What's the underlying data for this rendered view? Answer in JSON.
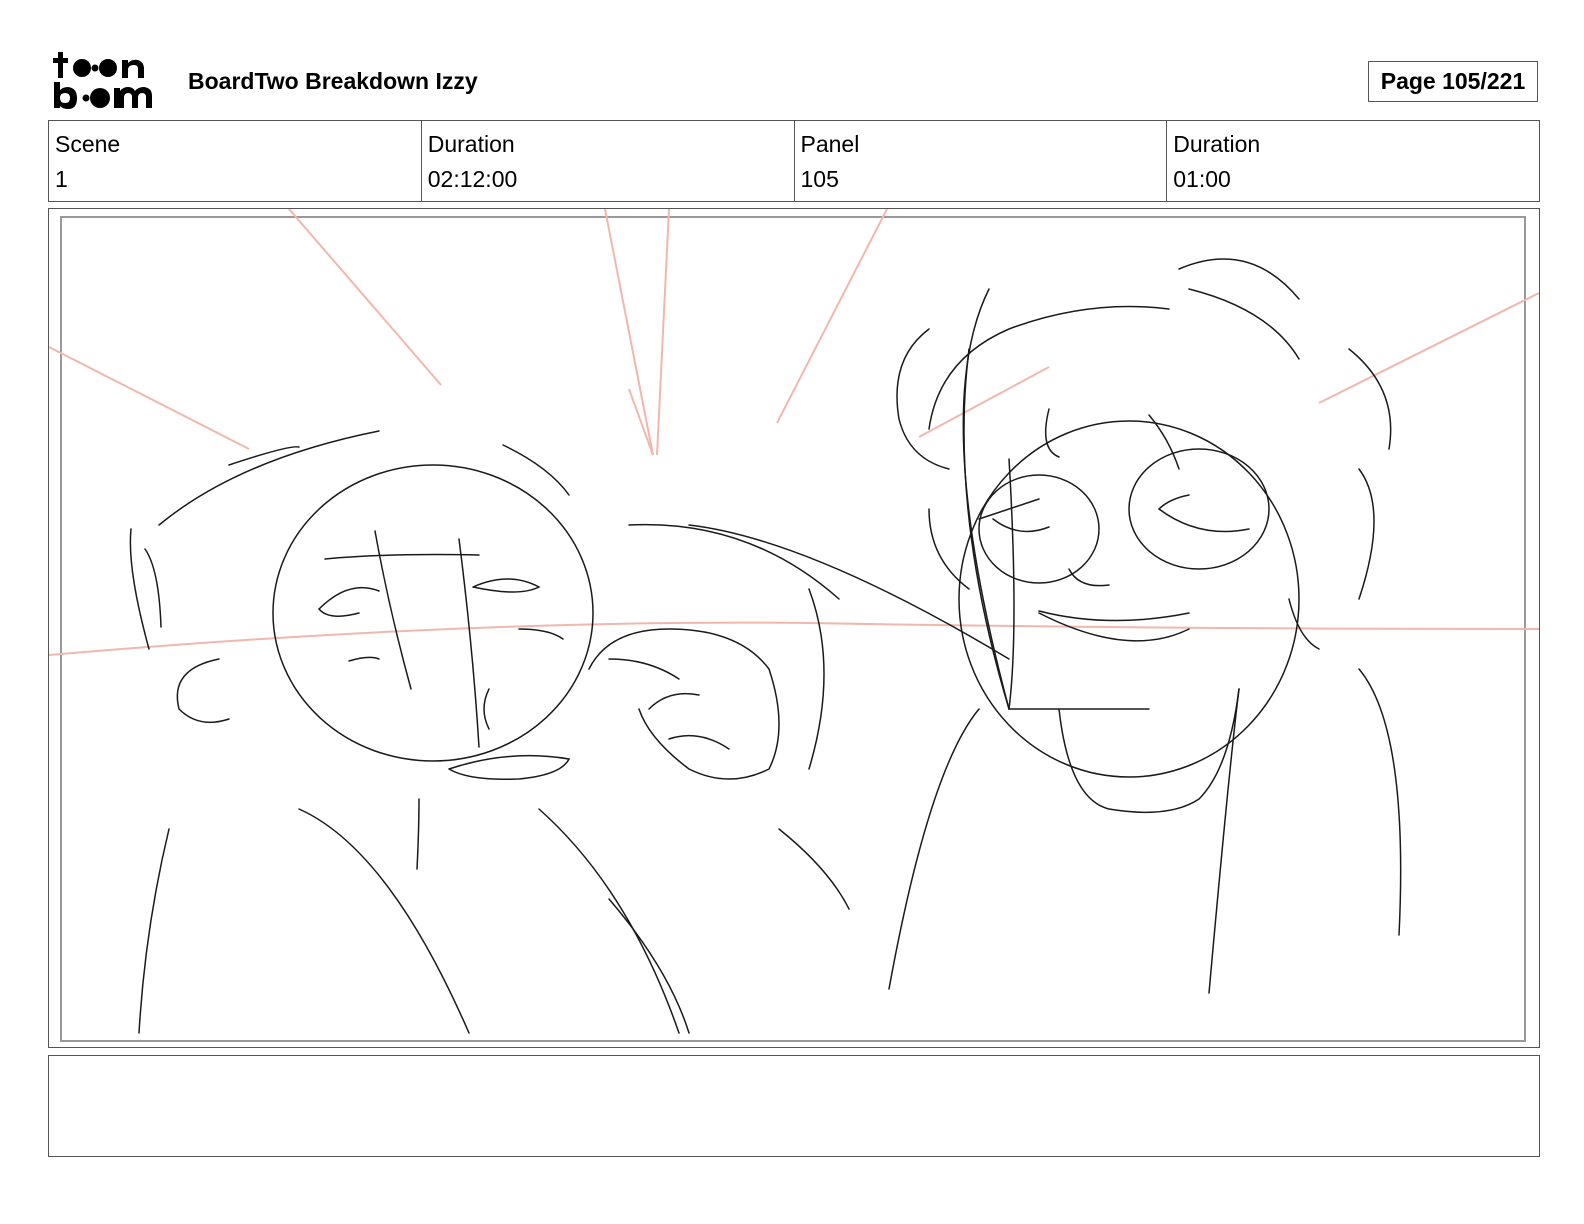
{
  "header": {
    "logo_text": "toonboom",
    "project_title": "BoardTwo Breakdown Izzy",
    "page_label": "Page 105/221"
  },
  "info": [
    {
      "label": "Scene",
      "value": "1"
    },
    {
      "label": "Duration",
      "value": "02:12:00"
    },
    {
      "label": "Panel",
      "value": "105"
    },
    {
      "label": "Duration",
      "value": "01:00"
    }
  ],
  "panel": {
    "line_color": "#1a1a1a",
    "guide_color": "#f0b8ac"
  },
  "notes": {
    "text": ""
  }
}
